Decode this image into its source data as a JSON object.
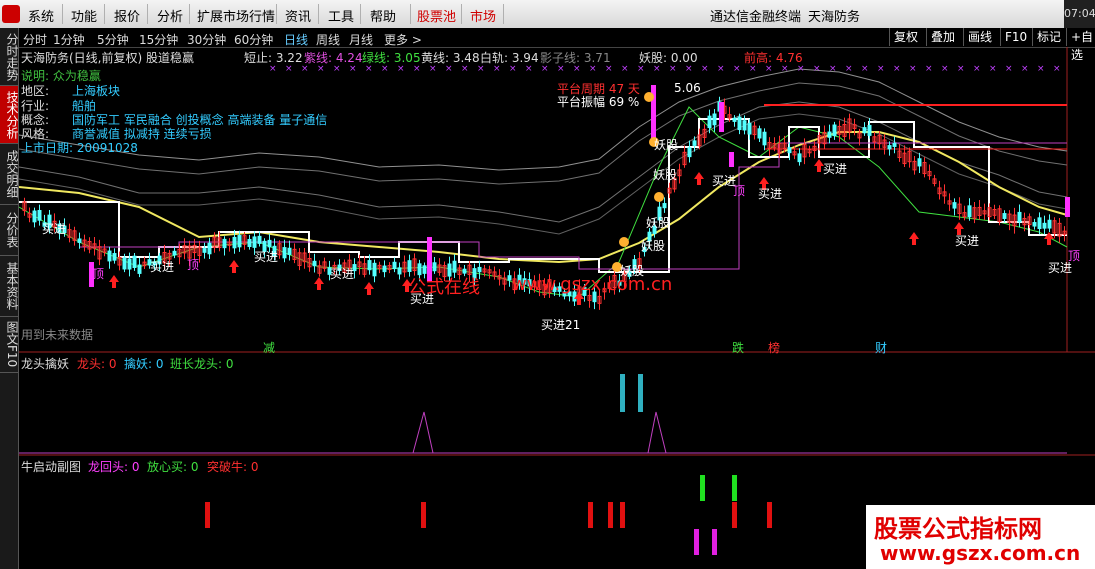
{
  "menu": {
    "items": [
      "系统",
      "功能",
      "报价",
      "分析",
      "扩展市场行情",
      "资讯",
      "工具",
      "帮助"
    ],
    "highlight_items": [
      "股票池",
      "市场"
    ],
    "app_name": "通达信金融终端",
    "stock_name": "天海防务",
    "clock": "07:04"
  },
  "sidebar": {
    "tabs": [
      "分时走势",
      "技术分析",
      "成交明细",
      "分价表",
      "基本资料",
      "图文F10"
    ],
    "active_index": 1
  },
  "periods": {
    "items": [
      "分时",
      "1分钟",
      "5分钟",
      "15分钟",
      "30分钟",
      "60分钟",
      "日线",
      "周线",
      "月线",
      "更多 >"
    ],
    "active": "日线"
  },
  "toolbar": {
    "buttons": [
      "复权",
      "叠加",
      "画线",
      "F10",
      "标记",
      "+自选"
    ]
  },
  "main_header": {
    "title": "天海防务(日线,前复权) 股道稳赢",
    "short_stop": "短止: 3.22",
    "purple_line": "紫线: 4.24",
    "green_line": "绿线: 3.05",
    "yellow_line": "黄线: 3.48",
    "white_rail": "白轨: 3.94",
    "shadow_line": "影子线: 3.71",
    "demon": "妖股: 0.00",
    "prev_high": "前高: 4.76"
  },
  "stock_info": {
    "explain": "说明: 众为稳赢",
    "region_label": "地区:",
    "region": "上海板块",
    "industry_label": "行业:",
    "industry": "船舶",
    "concept_label": "概念:",
    "concept": "国防军工 军民融合 创投概念 高端装备 量子通信",
    "style_label": "风格:",
    "style": "商誉减值 拟减持 连续亏损",
    "listing": "上市日期: 20091028"
  },
  "annotations": {
    "platform_cycle": "平台周期 47 天",
    "platform_amp": "平台振幅 69 %",
    "high_price": "5.06",
    "buy": "买进",
    "buy21": "买进21",
    "demon": "妖股",
    "use_future": "用到未来数据",
    "ding": "顶",
    "jian": "减",
    "die": "跌",
    "bang": "榜",
    "cai": "财"
  },
  "watermark": {
    "text1": "公式在线",
    "text2": "www.gszx.com.cn"
  },
  "pane2": {
    "title": "龙头擒妖",
    "dragon_head": "龙头: 0",
    "catch_demon": "擒妖: 0",
    "leader_dragon": "班长龙头: 0"
  },
  "pane3": {
    "title": "牛启动副图",
    "dragon_back": "龙回头: 0",
    "safe_buy": "放心买: 0",
    "breakout_bull": "突破牛: 0"
  },
  "brand": {
    "line1": "股票公式指标网",
    "line2": "www.gszx.com.cn"
  },
  "colors": {
    "bg": "#000000",
    "up": "#ff3232",
    "down": "#54ffff",
    "yellow_ma": "#f0e860",
    "white_rail": "#ffffff",
    "purple": "#c040c0",
    "green": "#40e040",
    "magenta_bar": "#ff30ff",
    "pane_line": "#c040c0"
  }
}
